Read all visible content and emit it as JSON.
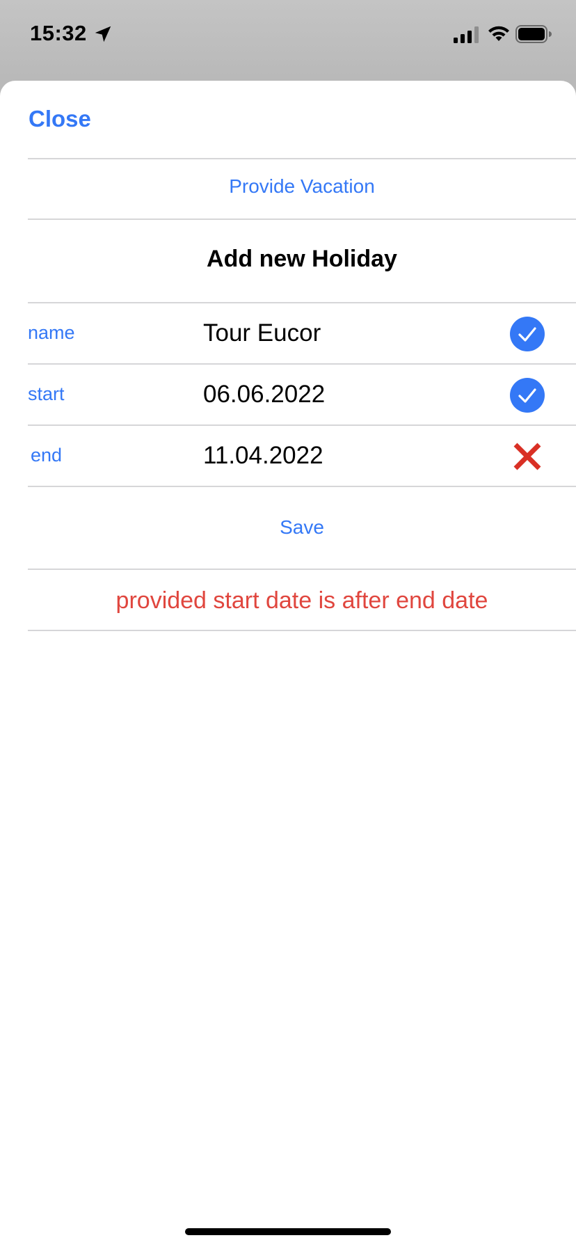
{
  "status_bar": {
    "time": "15:32",
    "icons": [
      "location-arrow-icon",
      "cellular-signal-icon",
      "wifi-icon",
      "battery-icon"
    ]
  },
  "sheet": {
    "close_label": "Close",
    "provide_vacation_label": "Provide Vacation",
    "title": "Add new Holiday",
    "fields": [
      {
        "label": "name",
        "value": "Tour Eucor",
        "valid": true,
        "status_icon": "checkmark-circle-icon"
      },
      {
        "label": "start",
        "value": "06.06.2022",
        "valid": true,
        "status_icon": "checkmark-circle-icon"
      },
      {
        "label": "end",
        "value": "11.04.2022",
        "valid": false,
        "status_icon": "red-x-icon"
      }
    ],
    "save_label": "Save",
    "error_message": "provided start date is after end date"
  },
  "colors": {
    "accent": "#3478f6",
    "error": "#e0463e",
    "invalid_icon": "#d93025",
    "divider": "#d6d6d8"
  }
}
